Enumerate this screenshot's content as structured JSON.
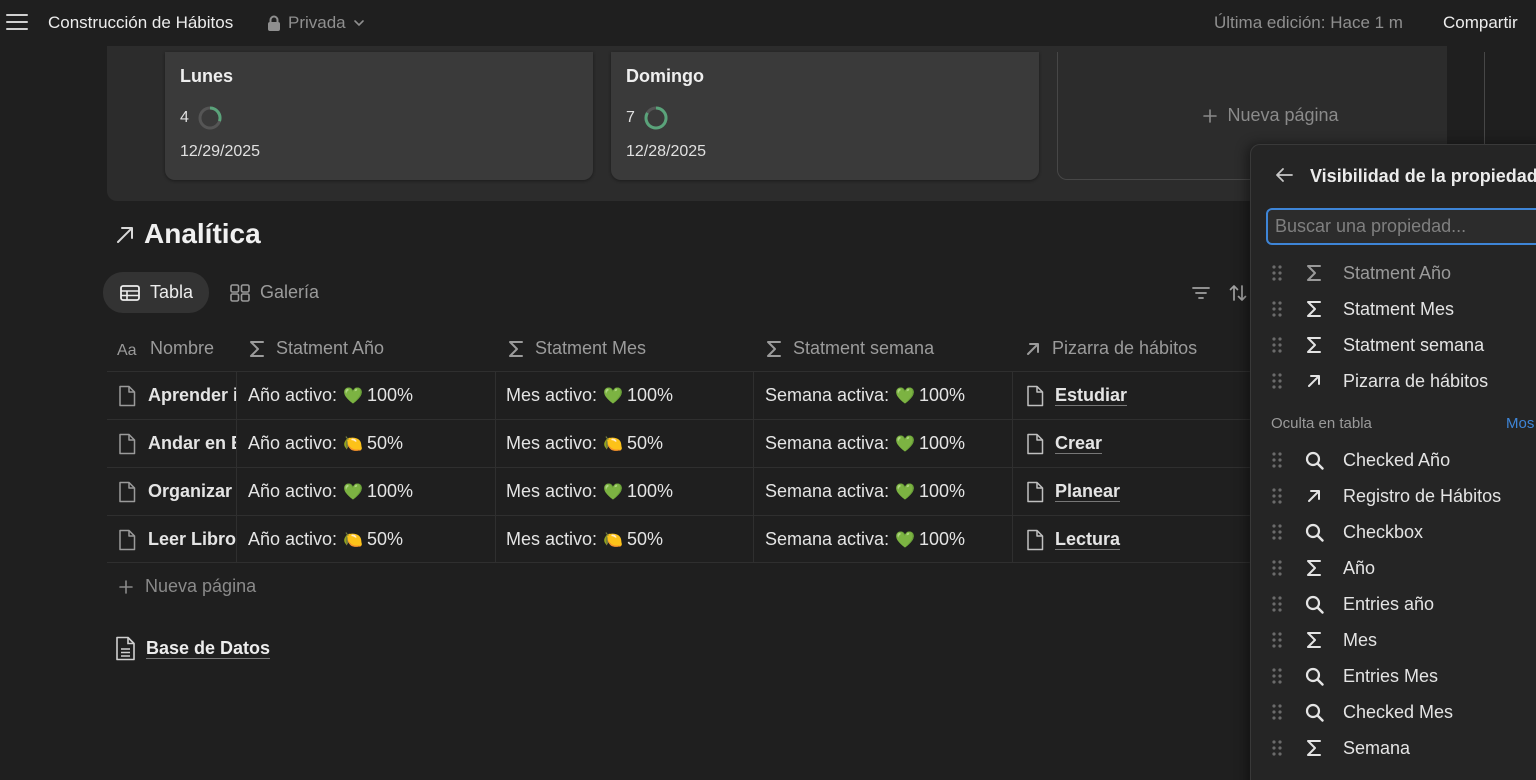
{
  "topbar": {
    "title": "Construcción de Hábitos",
    "privacy": "Privada",
    "last_edit": "Última edición: Hace 1 m",
    "share": "Compartir"
  },
  "board": {
    "cards": [
      {
        "title": "Lunes",
        "count": "4",
        "date": "12/29/2025"
      },
      {
        "title": "Domingo",
        "count": "7",
        "date": "12/28/2025"
      }
    ],
    "new_page": "Nueva página"
  },
  "analytics": {
    "title": "Analítica",
    "tabs": [
      {
        "label": "Tabla",
        "icon": "table-icon"
      },
      {
        "label": "Galería",
        "icon": "gallery-icon"
      }
    ]
  },
  "table": {
    "headers": [
      {
        "label": "Nombre",
        "icon": "text-type-icon"
      },
      {
        "label": "Statment Año",
        "icon": "sigma-icon"
      },
      {
        "label": "Statment Mes",
        "icon": "sigma-icon"
      },
      {
        "label": "Statment semana",
        "icon": "sigma-icon"
      },
      {
        "label": "Pizarra de hábitos",
        "icon": "relation-arrow-icon"
      }
    ],
    "rows": [
      {
        "name": "Aprender i",
        "year_label": "Año activo:",
        "year_emoji": "💚",
        "year_value": "100%",
        "month_label": "Mes activo:",
        "month_emoji": "💚",
        "month_value": "100%",
        "week_label": "Semana activa:",
        "week_emoji": "💚",
        "week_value": "100%",
        "relation": "Estudiar"
      },
      {
        "name": "Andar en B",
        "year_label": "Año activo:",
        "year_emoji": "🍋",
        "year_value": "50%",
        "month_label": "Mes activo:",
        "month_emoji": "🍋",
        "month_value": "50%",
        "week_label": "Semana activa:",
        "week_emoji": "💚",
        "week_value": "100%",
        "relation": "Crear"
      },
      {
        "name": "Organizar",
        "year_label": "Año activo:",
        "year_emoji": "💚",
        "year_value": "100%",
        "month_label": "Mes activo:",
        "month_emoji": "💚",
        "month_value": "100%",
        "week_label": "Semana activa:",
        "week_emoji": "💚",
        "week_value": "100%",
        "relation": "Planear"
      },
      {
        "name": "Leer Libro",
        "year_label": "Año activo:",
        "year_emoji": "🍋",
        "year_value": "50%",
        "month_label": "Mes activo:",
        "month_emoji": "🍋",
        "month_value": "50%",
        "week_label": "Semana activa:",
        "week_emoji": "💚",
        "week_value": "100%",
        "relation": "Lectura"
      }
    ],
    "new_row": "Nueva página"
  },
  "database_link": "Base de Datos",
  "panel": {
    "title": "Visibilidad de la propiedad",
    "search_placeholder": "Buscar una propiedad...",
    "visible": [
      {
        "label": "Statment Año",
        "icon": "sigma-icon",
        "dim": true
      },
      {
        "label": "Statment Mes",
        "icon": "sigma-icon"
      },
      {
        "label": "Statment semana",
        "icon": "sigma-icon"
      },
      {
        "label": "Pizarra de hábitos",
        "icon": "relation-arrow-icon"
      }
    ],
    "hidden_section": "Oculta en tabla",
    "hidden_action": "Mos",
    "hidden": [
      {
        "label": "Checked Año",
        "icon": "search-icon"
      },
      {
        "label": "Registro de Hábitos",
        "icon": "relation-arrow-icon"
      },
      {
        "label": "Checkbox",
        "icon": "search-icon"
      },
      {
        "label": "Año",
        "icon": "sigma-icon"
      },
      {
        "label": "Entries año",
        "icon": "search-icon"
      },
      {
        "label": "Mes",
        "icon": "sigma-icon"
      },
      {
        "label": "Entries Mes",
        "icon": "search-icon"
      },
      {
        "label": "Checked Mes",
        "icon": "search-icon"
      },
      {
        "label": "Semana",
        "icon": "sigma-icon"
      }
    ]
  },
  "colors": {
    "background": "#1f1f1f",
    "accent": "#3e85d7",
    "progress_ring": "#5aa37a"
  }
}
